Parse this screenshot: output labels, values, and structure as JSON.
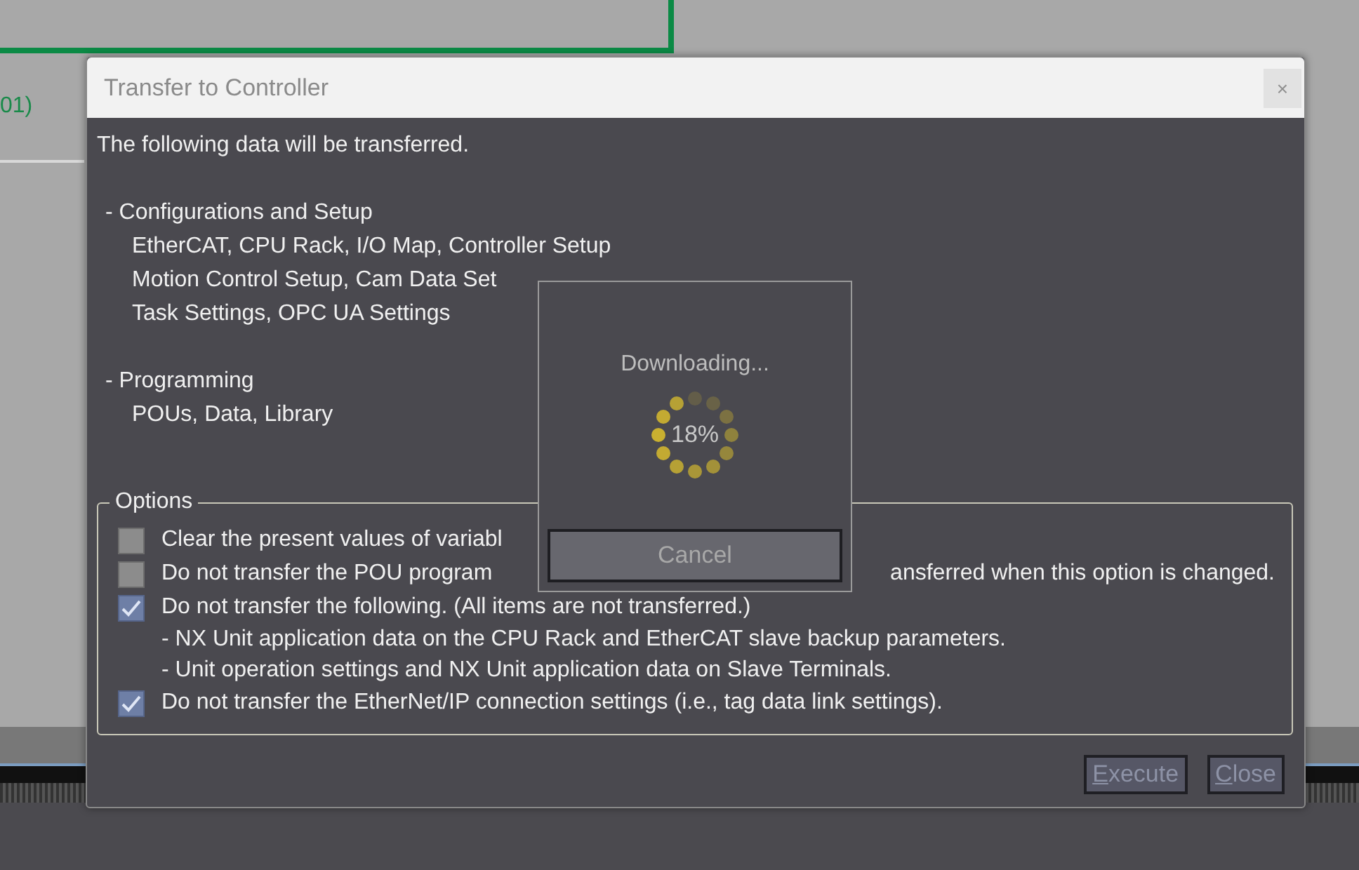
{
  "background": {
    "fragment_text": "01)"
  },
  "dialog": {
    "title": "Transfer to Controller",
    "close_label": "×",
    "intro": "The following data will be transferred.",
    "sections": [
      {
        "heading": "- Configurations and Setup",
        "lines": [
          "EtherCAT, CPU Rack, I/O Map, Controller Setup",
          "Motion Control Setup, Cam Data Set",
          "Task Settings, OPC UA Settings"
        ]
      },
      {
        "heading": "- Programming",
        "lines": [
          "POUs, Data, Library"
        ]
      }
    ],
    "options": {
      "legend": "Options",
      "items": [
        {
          "text": "Clear the present values of variabl",
          "checked": false
        },
        {
          "text": "Do not transfer the POU program",
          "text_after": "ansferred when this option is changed.",
          "checked": false
        },
        {
          "text": "Do not transfer the following. (All items are not transferred.)",
          "checked": true,
          "sub": [
            "- NX Unit application data on the CPU Rack and EtherCAT slave backup parameters.",
            "- Unit operation settings and NX Unit application data on Slave Terminals."
          ]
        },
        {
          "text": "Do not transfer the EtherNet/IP connection settings (i.e., tag data link settings).",
          "checked": true
        }
      ]
    },
    "buttons": [
      {
        "label": "Execute",
        "disabled": true
      },
      {
        "label": "Close",
        "disabled": true
      }
    ]
  },
  "progress_popup": {
    "message": "Downloading...",
    "percent": "18%",
    "button": "Cancel"
  }
}
